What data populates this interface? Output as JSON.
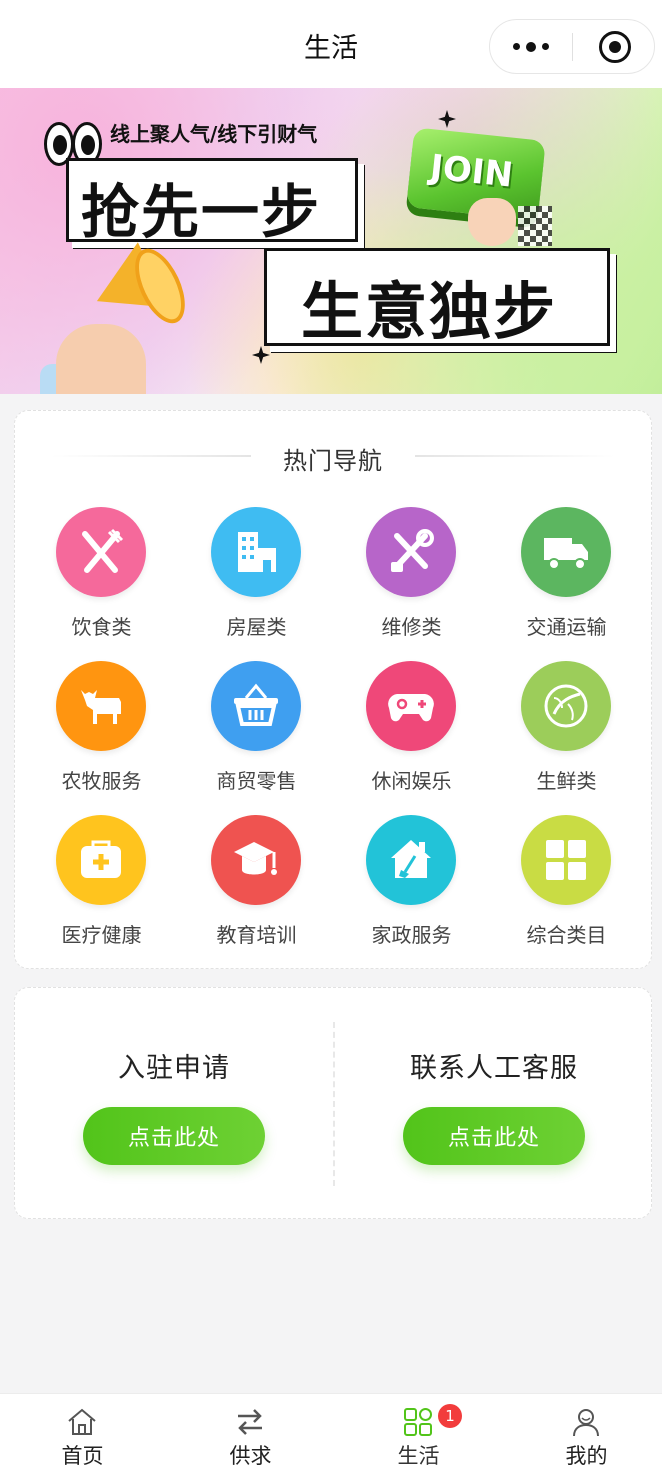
{
  "header": {
    "title": "生活",
    "more_icon": "more-dots-icon",
    "close_icon": "target-icon"
  },
  "banner": {
    "subtitle": "线上聚人气/线下引财气",
    "headline1": "抢先一步",
    "headline2": "生意独步",
    "join_label": "JOIN"
  },
  "hot_nav": {
    "title": "热门导航",
    "items": [
      {
        "label": "饮食类",
        "icon": "utensils-icon",
        "color": "#f5699b"
      },
      {
        "label": "房屋类",
        "icon": "building-icon",
        "color": "#3fbcf2"
      },
      {
        "label": "维修类",
        "icon": "tools-icon",
        "color": "#b765c9"
      },
      {
        "label": "交通运输",
        "icon": "truck-icon",
        "color": "#5cb660"
      },
      {
        "label": "农牧服务",
        "icon": "cow-icon",
        "color": "#ff9510"
      },
      {
        "label": "商贸零售",
        "icon": "basket-icon",
        "color": "#3f9ff0"
      },
      {
        "label": "休闲娱乐",
        "icon": "gamepad-icon",
        "color": "#ef4879"
      },
      {
        "label": "生鲜类",
        "icon": "cabbage-icon",
        "color": "#9ccd5a"
      },
      {
        "label": "医疗健康",
        "icon": "medical-kit-icon",
        "color": "#ffc41e"
      },
      {
        "label": "教育培训",
        "icon": "graduation-cap-icon",
        "color": "#ef5350"
      },
      {
        "label": "家政服务",
        "icon": "house-clean-icon",
        "color": "#22c3d8"
      },
      {
        "label": "综合类目",
        "icon": "grid-icon",
        "color": "#c9dc44"
      }
    ]
  },
  "actions": {
    "apply": {
      "title": "入驻申请",
      "button": "点击此处"
    },
    "service": {
      "title": "联系人工客服",
      "button": "点击此处"
    }
  },
  "tabbar": {
    "items": [
      {
        "label": "首页",
        "icon": "home-icon"
      },
      {
        "label": "供求",
        "icon": "exchange-icon"
      },
      {
        "label": "生活",
        "icon": "apps-icon",
        "badge": "1",
        "active": true
      },
      {
        "label": "我的",
        "icon": "user-icon"
      }
    ],
    "active_color": "#52c41a"
  }
}
